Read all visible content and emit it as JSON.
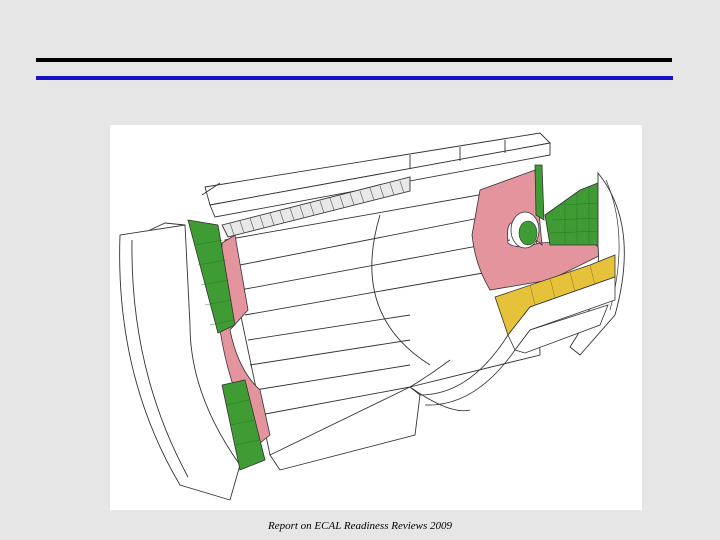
{
  "slide": {
    "footer_text": "Report on ECAL Readiness Reviews 2009"
  },
  "colors": {
    "background": "#e6e6e6",
    "rule_top": "#000000",
    "rule_bottom": "#1a10c8",
    "preshower_green": "#3f9c35",
    "endcap_pink": "#e3949c",
    "barrel_yellow": "#e6c23a"
  }
}
